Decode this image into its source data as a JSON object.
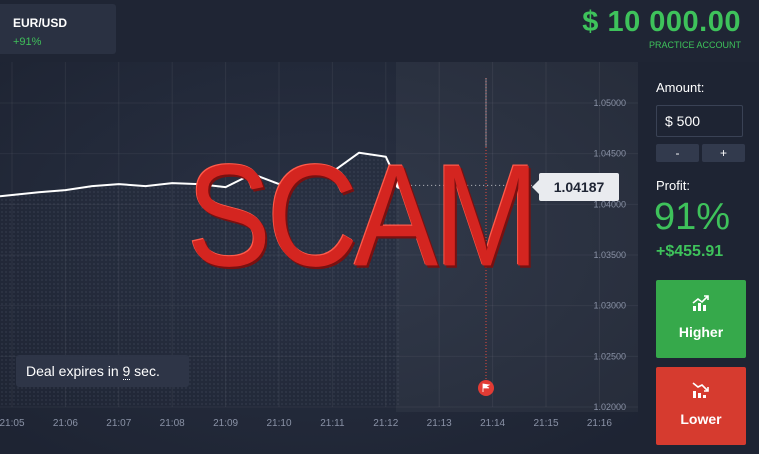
{
  "asset": {
    "name": "EUR/USD",
    "payout": "+91%"
  },
  "account": {
    "balance": "$ 10 000.00",
    "type": "PRACTICE ACCOUNT"
  },
  "chart": {
    "current_price": "1.04187",
    "y_ticks": [
      "1.05000",
      "1.04500",
      "1.04000",
      "1.03500",
      "1.03000",
      "1.02500",
      "1.02000"
    ],
    "x_ticks": [
      "21:05",
      "21:06",
      "21:07",
      "21:08",
      "21:09",
      "21:10",
      "21:11",
      "21:12",
      "21:13",
      "21:14",
      "21:15",
      "21:16"
    ],
    "deal_prefix": "Deal expires in ",
    "deal_seconds": "9",
    "deal_suffix": " sec.",
    "overlay_text": "SCAM"
  },
  "chart_data": {
    "type": "area",
    "x": [
      "21:05",
      "21:05:30",
      "21:06",
      "21:06:30",
      "21:07",
      "21:07:30",
      "21:08",
      "21:08:30",
      "21:09",
      "21:09:30",
      "21:10",
      "21:10:30",
      "21:11",
      "21:11:30",
      "21:12",
      "21:12:15"
    ],
    "series": [
      {
        "values": [
          1.0408,
          1.0412,
          1.0414,
          1.0418,
          1.042,
          1.0418,
          1.0421,
          1.042,
          1.0417,
          1.043,
          1.042,
          1.0436,
          1.0432,
          1.0451,
          1.0447,
          1.04187
        ]
      }
    ],
    "ylim": [
      1.02,
      1.05
    ],
    "grid": true,
    "colors": {
      "line": "#ffffff",
      "up": "#36a94b",
      "down": "#d63b2f"
    }
  },
  "sidebar": {
    "amount_label": "Amount:",
    "amount_value": "$ 500",
    "minus_label": "-",
    "plus_label": "+",
    "profit_label": "Profit:",
    "profit_percent": "91%",
    "profit_amount": "+$455.91",
    "higher_label": "Higher",
    "lower_label": "Lower"
  },
  "icons": {
    "higher": "trend-up-icon",
    "lower": "trend-down-icon",
    "expiry_flag": "flag-icon"
  }
}
